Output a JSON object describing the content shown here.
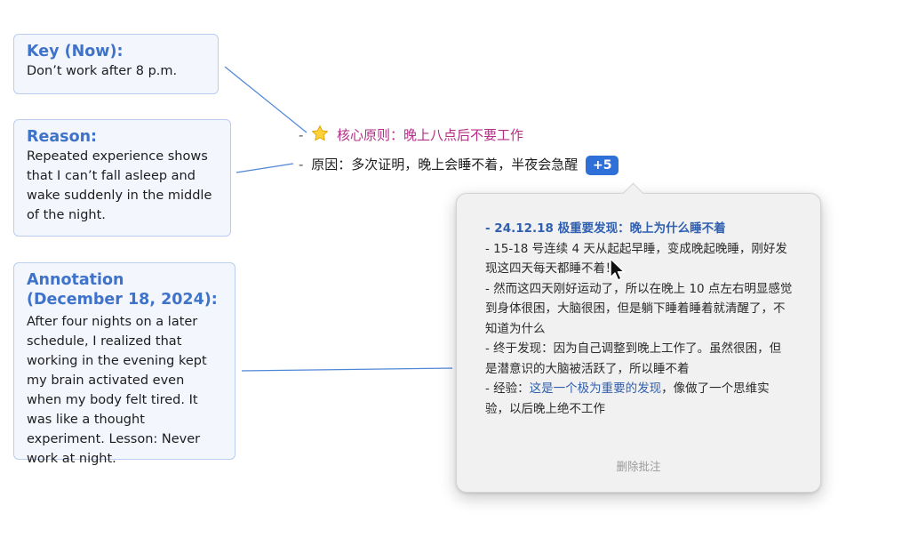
{
  "notes": {
    "key": {
      "title": "Key (Now):",
      "body": "Don’t work after 8 p.m."
    },
    "reason": {
      "title": "Reason:",
      "body": "Repeated experience shows that I can’t fall asleep and wake suddenly in the middle of the night."
    },
    "annotation": {
      "title": "Annotation (December 18, 2024):",
      "body": "After four nights on a later schedule, I realized that working in the evening kept my brain activated even when my body felt tired. It was like a thought experiment. Lesson: Never work at night."
    }
  },
  "outline": {
    "core": {
      "bullet": "-",
      "icon": "star-icon",
      "text": "核心原则：晚上八点后不要工作"
    },
    "reason": {
      "bullet": "-",
      "text": "原因：多次证明，晚上会睡不着，半夜会急醒",
      "badge": "+5"
    }
  },
  "popover": {
    "heading": "- 24.12.18 极重要发现：晚上为什么睡不着",
    "lines": [
      "- 15-18 号连续 4 天从起起早睡，变成晚起晚睡，刚好发现这四天每天都睡不着！",
      "- 然而这四天刚好运动了，所以在晚上 10 点左右明显感觉到身体很困，大脑很困，但是躺下睡着睡着就清醒了，不知道为什么",
      "- 终于发现：因为自己调整到晚上工作了。虽然很困，但是潜意识的大脑被活跃了，所以睡不着"
    ],
    "last_line": {
      "prefix": "- 经验：",
      "highlight": "这是一个极为重要的发现",
      "suffix": "，像做了一个思维实验，以后晚上绝不工作"
    },
    "footer": "删除批注"
  },
  "colors": {
    "note_title": "#3e73c9",
    "note_border": "#b9cdee",
    "core_text": "#b42d86",
    "badge": "#2f6fd8",
    "connector": "#4f86d6",
    "popover_bg": "#f1f1f1"
  }
}
